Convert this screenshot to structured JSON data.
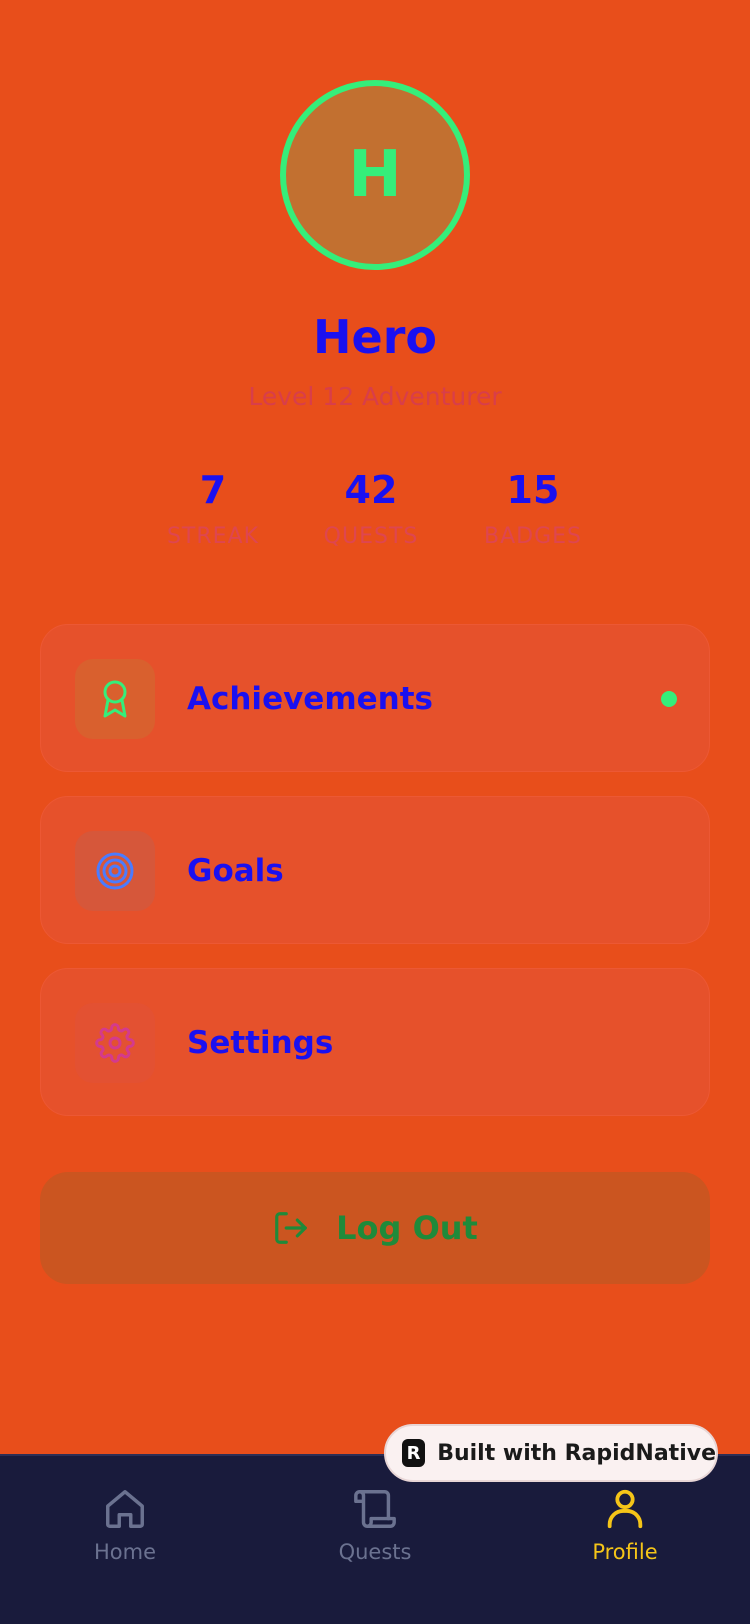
{
  "profile": {
    "avatar_initial": "H",
    "name": "Hero",
    "subtitle": "Level 12 Adventurer"
  },
  "stats": [
    {
      "value": "7",
      "label": "STREAK"
    },
    {
      "value": "42",
      "label": "QUESTS"
    },
    {
      "value": "15",
      "label": "BADGES"
    }
  ],
  "menu": [
    {
      "label": "Achievements",
      "icon": "award-icon",
      "has_indicator": true
    },
    {
      "label": "Goals",
      "icon": "target-icon",
      "has_indicator": false
    },
    {
      "label": "Settings",
      "icon": "gear-icon",
      "has_indicator": false
    }
  ],
  "logout": {
    "label": "Log Out",
    "icon": "logout-icon"
  },
  "tabs": [
    {
      "label": "Home",
      "icon": "home-icon",
      "active": false
    },
    {
      "label": "Quests",
      "icon": "scroll-icon",
      "active": false
    },
    {
      "label": "Profile",
      "icon": "user-icon",
      "active": true
    }
  ],
  "badge": {
    "label": "Built with RapidNative"
  },
  "colors": {
    "background": "#E84E1B",
    "accent_green": "#35EE7A",
    "text_blue": "#1A10F0",
    "tab_bar": "#191B3C",
    "tab_active": "#F5C518",
    "tab_inactive": "#6B7290"
  }
}
